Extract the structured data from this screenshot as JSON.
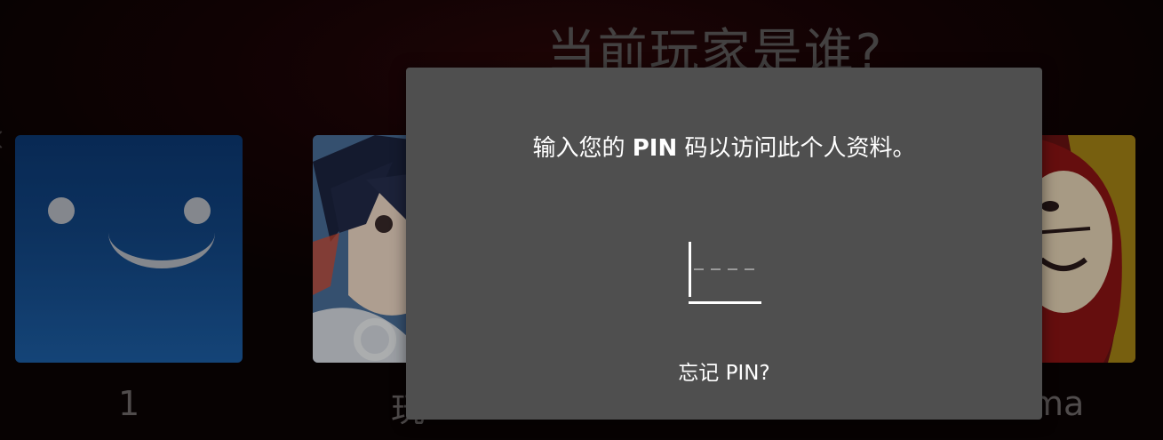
{
  "header": {
    "title": "当前玩家是谁?"
  },
  "profiles": [
    {
      "name": "1",
      "avatar_icon": "smiley-face-icon",
      "avatar_color": "#124684"
    },
    {
      "name": "玩",
      "avatar_icon": "anime-character-avatar",
      "avatar_color": "#3b628f"
    },
    {
      "name": "ma",
      "avatar_icon": "masked-hooded-avatar",
      "avatar_color": "#6a1010"
    }
  ],
  "dialog": {
    "prompt_pre": "输入您的 ",
    "prompt_bold": "PIN",
    "prompt_post": " 码以访问此个人资料。",
    "pin_value": "",
    "pin_length": 4,
    "forgot_label": "忘记 PIN?"
  },
  "colors": {
    "dialog_background": "#4f4f4f",
    "page_background": "#170405",
    "text": "#ffffff"
  }
}
